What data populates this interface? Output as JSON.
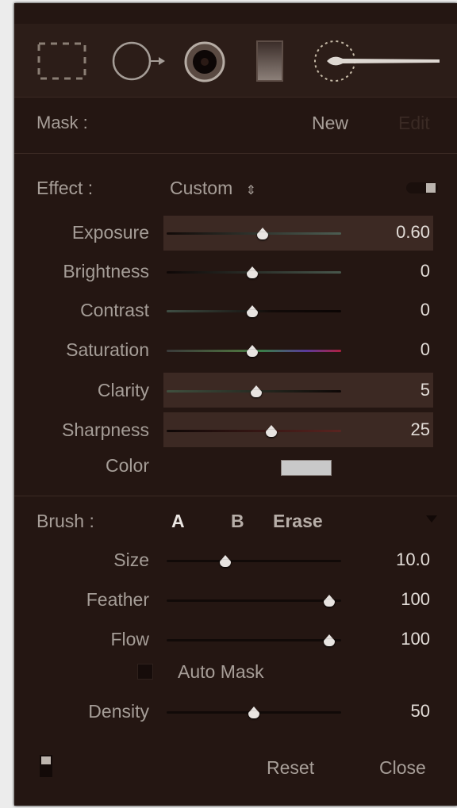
{
  "mask": {
    "label": "Mask :",
    "new_label": "New",
    "edit_label": "Edit"
  },
  "effect": {
    "label": "Effect :",
    "preset": "Custom"
  },
  "sliders": [
    {
      "label": "Exposure",
      "value": "0.60",
      "position": 0.55,
      "highlighted": true
    },
    {
      "label": "Brightness",
      "value": "0",
      "position": 0.49,
      "highlighted": false
    },
    {
      "label": "Contrast",
      "value": "0",
      "position": 0.49,
      "highlighted": false
    },
    {
      "label": "Saturation",
      "value": "0",
      "position": 0.49,
      "highlighted": false
    },
    {
      "label": "Clarity",
      "value": "5",
      "position": 0.51,
      "highlighted": true
    },
    {
      "label": "Sharpness",
      "value": "25",
      "position": 0.6,
      "highlighted": true
    }
  ],
  "color": {
    "label": "Color",
    "swatch": "#c9c9c9"
  },
  "brush": {
    "label": "Brush :",
    "a_label": "A",
    "b_label": "B",
    "erase_label": "Erase",
    "sliders": [
      {
        "label": "Size",
        "value": "10.0",
        "position": 0.33
      },
      {
        "label": "Feather",
        "value": "100",
        "position": 0.93
      },
      {
        "label": "Flow",
        "value": "100",
        "position": 0.93
      }
    ],
    "auto_mask_label": "Auto Mask",
    "auto_mask_checked": false,
    "density": {
      "label": "Density",
      "value": "50",
      "position": 0.5
    }
  },
  "footer": {
    "reset_label": "Reset",
    "close_label": "Close"
  },
  "icons": [
    "crop-overlay-icon",
    "spot-removal-icon",
    "red-eye-icon",
    "graduated-filter-icon",
    "adjustment-brush-icon"
  ],
  "colors": {
    "panel": "#241612",
    "text": "#a79e98",
    "value_text": "#e2dcd7",
    "active": "#e7e2de"
  }
}
